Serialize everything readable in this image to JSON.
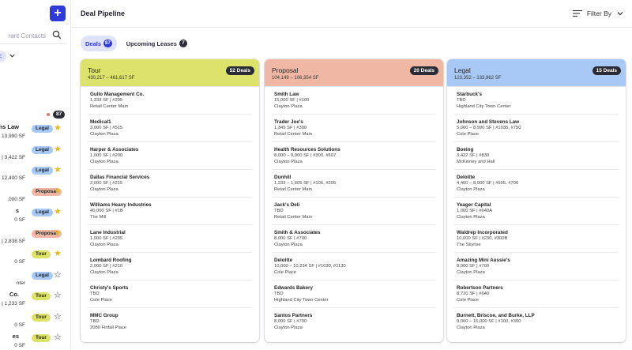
{
  "sidebar": {
    "add_label": "+",
    "search_placeholder": "rant Contacts",
    "filter_chip": "<",
    "total_count": "87",
    "contacts": [
      {
        "name": "ons Law",
        "meta": "0 | 13,990 SF",
        "tag": "Legal",
        "starred": true
      },
      {
        "name": "",
        "meta": "0 | 3,422 SF",
        "tag": "Legal",
        "starred": true
      },
      {
        "name": "",
        "meta": "700 | 12,400 SF",
        "tag": "Legal",
        "starred": true
      },
      {
        "name": "",
        "meta": ",000 SF",
        "tag": "Proposal",
        "starred": true
      },
      {
        "name": "s",
        "meta": "0 SF",
        "tag": "Legal",
        "starred": true
      },
      {
        "name": "",
        "meta": "5, #205 | 2,838 SF",
        "tag": "Proposal",
        "starred": true
      },
      {
        "name": "",
        "meta": "0 SF",
        "tag": "Tour",
        "starred": true
      },
      {
        "name": "",
        "meta": "nter",
        "tag": "Legal",
        "starred": false
      },
      {
        "name": "Co.",
        "meta": "5 | 1,233 SF",
        "tag": "Tour",
        "starred": false
      },
      {
        "name": "",
        "meta": "0 SF",
        "tag": "Tour",
        "starred": false
      },
      {
        "name": "es",
        "meta": "0 SF",
        "tag": "Tour",
        "starred": false
      }
    ]
  },
  "header": {
    "title": "Deal Pipeline",
    "filter_label": "Filter By"
  },
  "tabs": [
    {
      "label": "Deals",
      "count": "87",
      "active": true
    },
    {
      "label": "Upcoming Leases",
      "count": "7",
      "active": false
    }
  ],
  "colors": {
    "tour": "#dde26a",
    "proposal": "#f0b8a4",
    "legal": "#a8c8f5",
    "accent": "#2e3bd9"
  },
  "columns": [
    {
      "title": "Tour",
      "range": "430,217 – 461,617 SF",
      "badge": "52 Deals",
      "color": "#dde26a",
      "deals": [
        {
          "name": "Gullo Management Co.",
          "size": "1,233 SF | #205",
          "location": "Retail Center Main"
        },
        {
          "name": "Medical1",
          "size": "3,000 SF | #515",
          "location": "Clayton Plaza"
        },
        {
          "name": "Harper & Associates",
          "size": "1,000 SF | #200",
          "location": "Clayton Plaza"
        },
        {
          "name": "Dallas Financial Services",
          "size": "2,000 SF | #215",
          "location": "Clayton Plaza"
        },
        {
          "name": "Williams Heavy Industries",
          "size": "40,000 SF | #1B",
          "location": "The Mill"
        },
        {
          "name": "Lane Industrial",
          "size": "1,000 SF | #205",
          "location": "Clayton Plaza"
        },
        {
          "name": "Lombard Roofing",
          "size": "2,000 SF | #210",
          "location": "Clayton Plaza"
        },
        {
          "name": "Christy's Sports",
          "size": "TBD",
          "location": "Cole Place"
        },
        {
          "name": "MMC Group",
          "size": "TBD",
          "location": "2080 Finfall Place"
        }
      ]
    },
    {
      "title": "Proposal",
      "range": "104,149 – 106,354 SF",
      "badge": "20 Deals",
      "color": "#f0b8a4",
      "deals": [
        {
          "name": "Smith Law",
          "size": "15,000 SF | #100",
          "location": "Clayton Plaza"
        },
        {
          "name": "Trader Joe's",
          "size": "1,345 SF | #300",
          "location": "Retail Center Main"
        },
        {
          "name": "Health Resources Solutions",
          "size": "8,000 – 9,000 SF | #300, #607",
          "location": "Clayton Plaza"
        },
        {
          "name": "Dunhill",
          "size": "1,233 – 1,605 SF | #105, #205",
          "location": "Retail Center Main"
        },
        {
          "name": "Jack's Deli",
          "size": "TBD",
          "location": "Retail Center Main"
        },
        {
          "name": "Smith & Associates",
          "size": "8,000 SF | #700",
          "location": "Clayton Plaza"
        },
        {
          "name": "Deloitte",
          "size": "10,000 – 10,234 SF | #1030, #1130",
          "location": "Cole Place"
        },
        {
          "name": "Edwards Bakery",
          "size": "TBD",
          "location": "Highland City Town Center"
        },
        {
          "name": "Santos Partners",
          "size": "8,000 SF | #700",
          "location": "Clayton Plaza"
        }
      ]
    },
    {
      "title": "Legal",
      "range": "123,352 – 133,962 SF",
      "badge": "15 Deals",
      "color": "#a8c8f5",
      "deals": [
        {
          "name": "Starbuck's",
          "size": "TBD",
          "location": "Highland City Town Center"
        },
        {
          "name": "Johnson and Stevens Law",
          "size": "5,000 – 8,990 SF | #1035, #750",
          "location": "Cole Place"
        },
        {
          "name": "Boeing",
          "size": "3,422 SF | #830",
          "location": "McKinney and Hall"
        },
        {
          "name": "Deloitte",
          "size": "4,400 – 8,000 SF | #505, #700",
          "location": "Clayton Plaza"
        },
        {
          "name": "Yeager Capital",
          "size": "1,000 SF | #640A",
          "location": "Clayton Plaza"
        },
        {
          "name": "Waldrep Incorporated",
          "size": "10,000 SF | #230, #300B",
          "location": "The Skyrise"
        },
        {
          "name": "Amazing Mini Aussie's",
          "size": "8,000 SF | #700",
          "location": "Clayton Plaza"
        },
        {
          "name": "Robertson Partners",
          "size": "8,720 SF | #640",
          "location": "Cole Place"
        },
        {
          "name": "Burnett, Briscoe, and Burke, LLP",
          "size": "9,000 – 15,000 SF | #100, #300",
          "location": "Clayton Plaza"
        }
      ]
    }
  ]
}
